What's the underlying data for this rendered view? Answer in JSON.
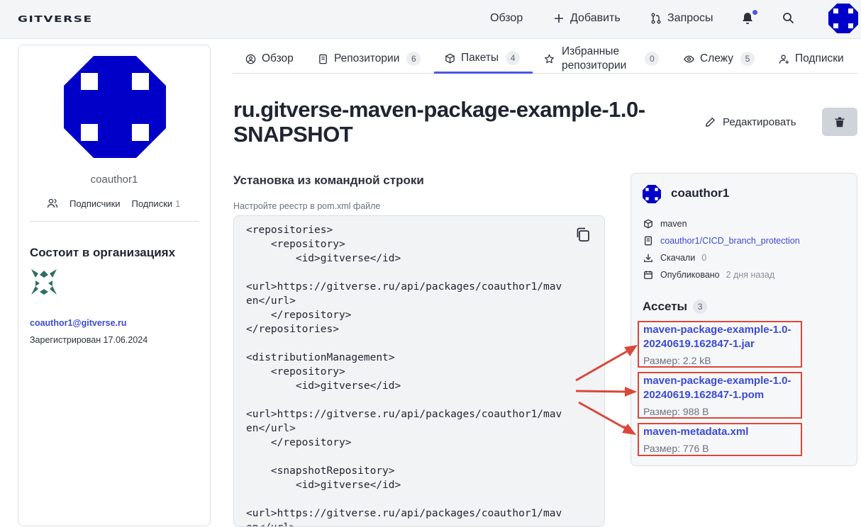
{
  "header": {
    "logo": "GITVERSE",
    "nav": [
      {
        "label": "Обзор",
        "icon": "none"
      },
      {
        "label": "Добавить",
        "icon": "plus-icon"
      },
      {
        "label": "Запросы",
        "icon": "pull-request-icon"
      }
    ],
    "accent": "#4a57e3"
  },
  "profile": {
    "username": "coauthor1",
    "followers_label": "Подписчики",
    "following_label": "Подписки",
    "following_count": "1",
    "orgs_title": "Состоит в организациях",
    "email": "coauthor1@gitverse.ru",
    "registered": "Зарегистрирован 17.06.2024"
  },
  "tabs": [
    {
      "label": "Обзор",
      "icon": "overview-icon",
      "count": ""
    },
    {
      "label": "Репозитории",
      "icon": "repo-icon",
      "count": "6"
    },
    {
      "label": "Пакеты",
      "icon": "package-icon",
      "count": "4",
      "active": true
    },
    {
      "label_line1": "Избранные",
      "label_line2": "репозитории",
      "icon": "star-icon",
      "count": "0"
    },
    {
      "label": "Слежу",
      "icon": "eye-icon",
      "count": "5"
    },
    {
      "label": "Подписки",
      "icon": "person-add-icon",
      "count": ""
    }
  ],
  "package": {
    "title": "ru.gitverse-maven-package-example-1.0-SNAPSHOT",
    "edit_label": "Редактировать"
  },
  "install": {
    "title": "Установка из командной строки",
    "hint": "Настройте реестр в pom.xml файле",
    "code": "<repositories>\n    <repository>\n        <id>gitverse</id>\n\n<url>https://gitverse.ru/api/packages/coauthor1/mav\nen</url>\n    </repository>\n</repositories>\n\n<distributionManagement>\n    <repository>\n        <id>gitverse</id>\n\n<url>https://gitverse.ru/api/packages/coauthor1/mav\nen</url>\n    </repository>\n\n    <snapshotRepository>\n        <id>gitverse</id>\n\n<url>https://gitverse.ru/api/packages/coauthor1/mav\nen</url>"
  },
  "info": {
    "user": "coauthor1",
    "type": "maven",
    "repo": "coauthor1/CICD_branch_protection",
    "downloads_label": "Скачали",
    "downloads": "0",
    "published_label": "Опубликовано",
    "published": "2 дня назад",
    "assets_title": "Ассеты",
    "assets_count": "3",
    "assets": [
      {
        "name_line1": "maven-package-example-1.0-",
        "name_line2": "20240619.162847-1.jar",
        "size": "Размер: 2.2 kB"
      },
      {
        "name_line1": "maven-package-example-1.0-",
        "name_line2": "20240619.162847-1.pom",
        "size": "Размер: 988 B"
      },
      {
        "name_line1": "maven-metadata.xml",
        "name_line2": "",
        "size": "Размер: 776 B"
      }
    ],
    "highlight_color": "#d9483b"
  }
}
